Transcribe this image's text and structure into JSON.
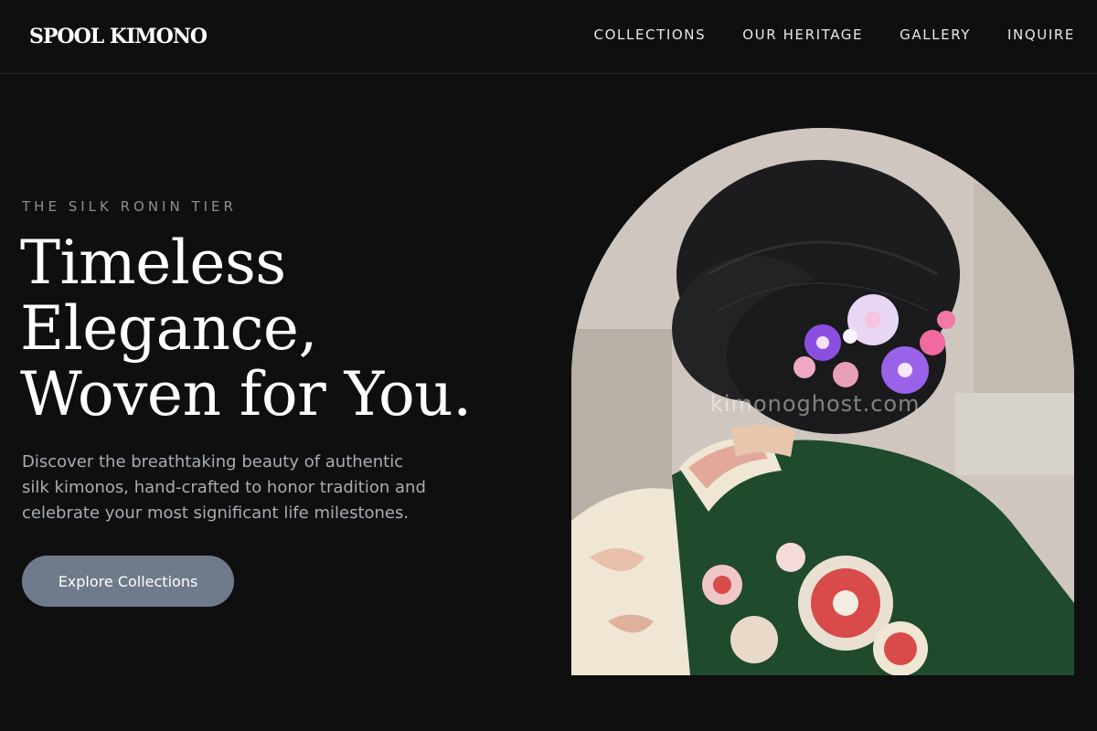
{
  "brand": {
    "logo_text": "SPOOL KIMONO"
  },
  "nav": {
    "items": [
      {
        "label": "COLLECTIONS"
      },
      {
        "label": "OUR HERITAGE"
      },
      {
        "label": "GALLERY"
      },
      {
        "label": "INQUIRE"
      }
    ]
  },
  "hero": {
    "eyebrow": "THE SILK RONIN TIER",
    "headline_lines": [
      "Timeless",
      "Elegance,",
      "Woven for You."
    ],
    "description_lines": [
      "Discover the breathtaking beauty of authentic",
      "silk kimonos, hand-crafted to honor tradition and",
      "celebrate your most significant life milestones."
    ],
    "cta_label": "Explore Collections"
  },
  "image": {
    "watermark": "kimonoghost.com",
    "colors": {
      "hair": "#1c1c1e",
      "kimono_green": "#1f4a2b",
      "collar_cream": "#efe6d4",
      "flower_purple": "#8a4fe0",
      "flower_pink": "#e7a0b8"
    }
  },
  "theme": {
    "background": "#0f0f0f",
    "button": "#6f7b8b",
    "muted_text": "#a8adb3"
  }
}
